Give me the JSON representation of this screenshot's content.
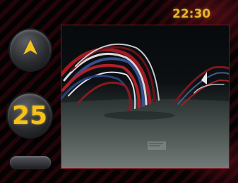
{
  "status_bar": {
    "time": "22:30"
  },
  "controls": {
    "navigation_button": {
      "icon": "navigation-arrow-icon"
    },
    "number_button": {
      "value": "25"
    },
    "bottom_button": {
      "label": ""
    }
  },
  "colors": {
    "accent": "#f4c21a",
    "frame": "#7a1822",
    "background": "#050203"
  }
}
